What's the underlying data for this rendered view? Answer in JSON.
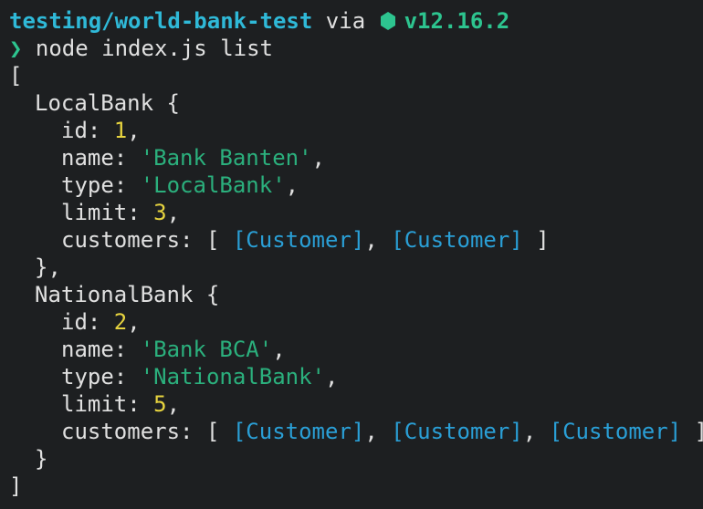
{
  "prompt": {
    "path": "testing/world-bank-test",
    "via": " via ",
    "node_icon": "hexagon-icon",
    "node_version": "v12.16.2",
    "symbol": "❯",
    "command": "node index.js list"
  },
  "output": {
    "open_bracket": "[",
    "close_bracket": "]",
    "banks": [
      {
        "class_name": "LocalBank",
        "id": "1",
        "name": "'Bank Banten'",
        "type": "'LocalBank'",
        "limit": "3",
        "customers": [
          "[Customer]",
          "[Customer]"
        ],
        "closing": "},"
      },
      {
        "class_name": "NationalBank",
        "id": "2",
        "name": "'Bank BCA'",
        "type": "'NationalBank'",
        "limit": "5",
        "customers": [
          "[Customer]",
          "[Customer]",
          "[Customer]"
        ],
        "closing": "}"
      }
    ]
  },
  "colors": {
    "background": "#1d1f21",
    "path": "#2fb9d8",
    "node": "#2dc48f",
    "number": "#e6d33f",
    "string": "#2bb07d",
    "reference": "#2a9fd6"
  }
}
